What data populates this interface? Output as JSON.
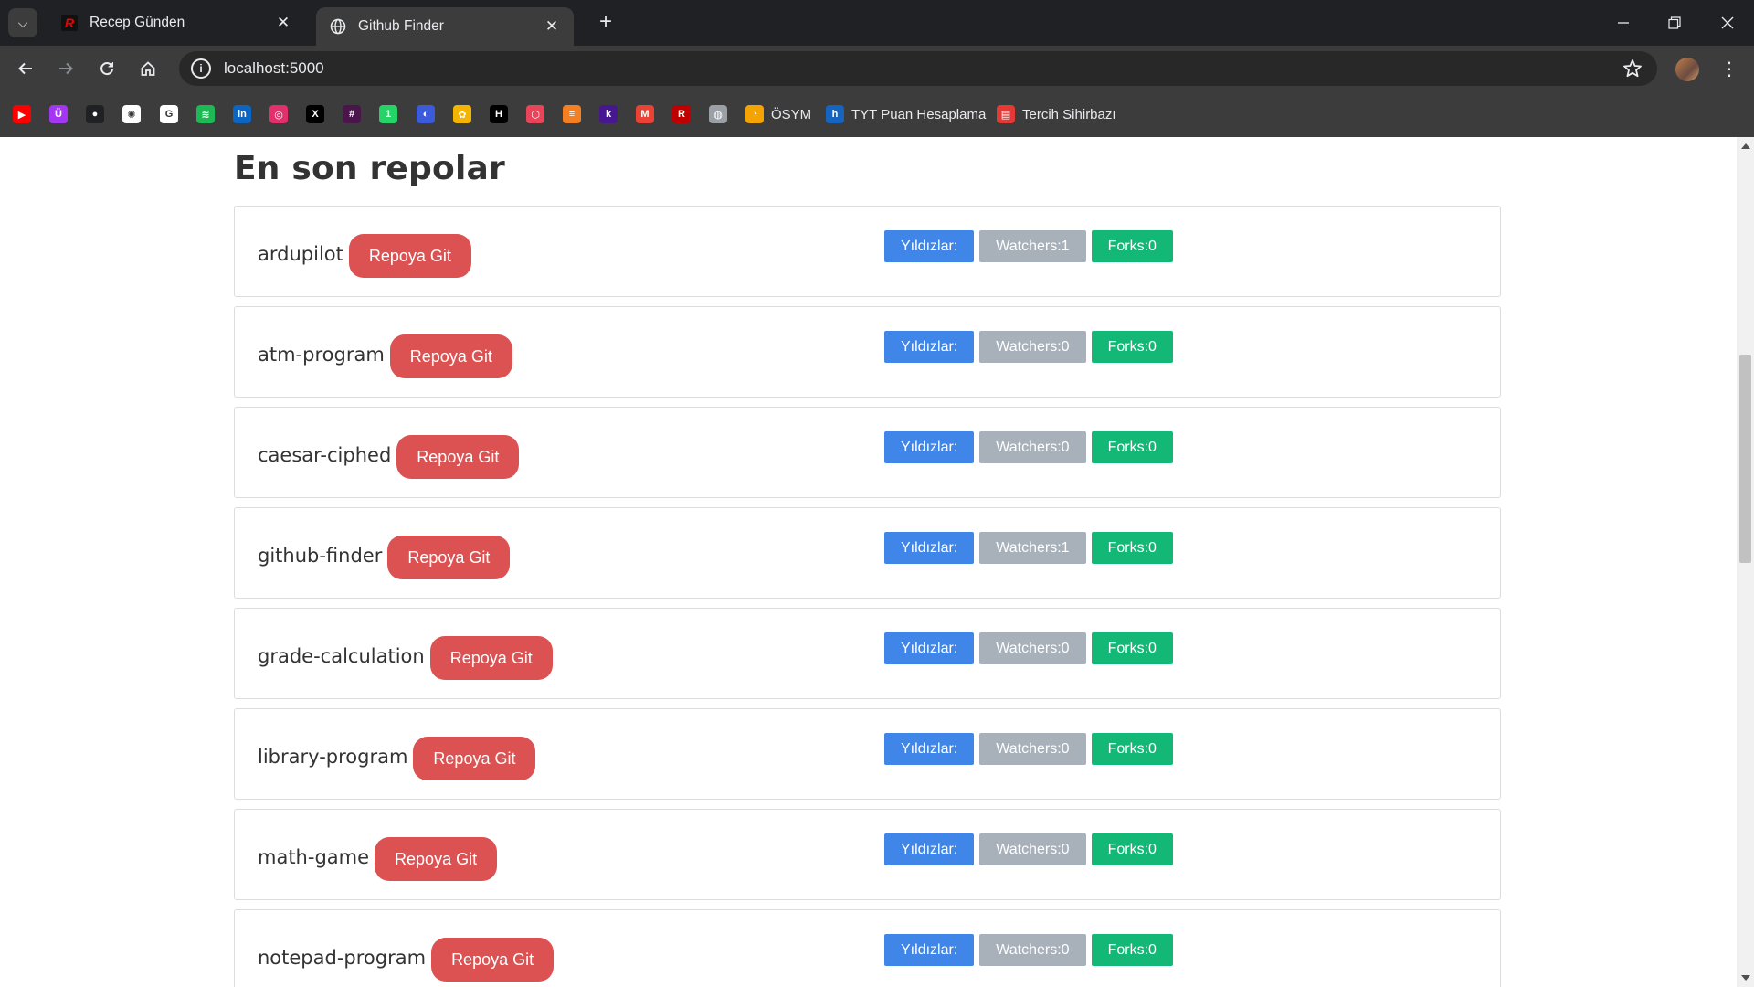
{
  "browser": {
    "tabs": [
      {
        "title": "Recep Günden",
        "active": false
      },
      {
        "title": "Github Finder",
        "active": true
      }
    ],
    "url": "localhost:5000",
    "bookmarks": [
      {
        "icon": "youtube-icon",
        "color": "#ff0000",
        "glyph": "▶",
        "label": ""
      },
      {
        "icon": "udemy-icon",
        "color": "#a435f0",
        "glyph": "Ü",
        "label": ""
      },
      {
        "icon": "github-icon",
        "color": "#202124",
        "glyph": "●",
        "label": ""
      },
      {
        "icon": "chatgpt-icon",
        "color": "#ffffff",
        "glyph": "✺",
        "label": ""
      },
      {
        "icon": "google-icon",
        "color": "#ffffff",
        "glyph": "G",
        "label": ""
      },
      {
        "icon": "spotify-icon",
        "color": "#1db954",
        "glyph": "≋",
        "label": ""
      },
      {
        "icon": "linkedin-icon",
        "color": "#0a66c2",
        "glyph": "in",
        "label": ""
      },
      {
        "icon": "instagram-icon",
        "color": "#e1306c",
        "glyph": "◎",
        "label": ""
      },
      {
        "icon": "x-icon",
        "color": "#000000",
        "glyph": "X",
        "label": ""
      },
      {
        "icon": "slack-icon",
        "color": "#4a154b",
        "glyph": "#",
        "label": ""
      },
      {
        "icon": "whatsapp-icon",
        "color": "#25d366",
        "glyph": "1",
        "label": ""
      },
      {
        "icon": "chrome-extension-icon",
        "color": "#3b5bdb",
        "glyph": "◐",
        "label": ""
      },
      {
        "icon": "photos-icon",
        "color": "#f4b400",
        "glyph": "✿",
        "label": ""
      },
      {
        "icon": "hackernoon-icon",
        "color": "#000000",
        "glyph": "H",
        "label": ""
      },
      {
        "icon": "codepen-icon",
        "color": "#e8445a",
        "glyph": "⬡",
        "label": ""
      },
      {
        "icon": "stackoverflow-icon",
        "color": "#f48024",
        "glyph": "≡",
        "label": ""
      },
      {
        "icon": "kahoot-icon",
        "color": "#46178f",
        "glyph": "k",
        "label": ""
      },
      {
        "icon": "gmail-icon",
        "color": "#ea4335",
        "glyph": "M",
        "label": ""
      },
      {
        "icon": "recep-icon",
        "color": "#c00000",
        "glyph": "R",
        "label": ""
      },
      {
        "icon": "globe-icon",
        "color": "#9aa0a6",
        "glyph": "◍",
        "label": ""
      },
      {
        "icon": "osym-icon",
        "color": "#f4a300",
        "glyph": "◔",
        "label": "ÖSYM"
      },
      {
        "icon": "tyt-icon",
        "color": "#1565c0",
        "glyph": "h",
        "label": "TYT Puan Hesaplama"
      },
      {
        "icon": "tercih-icon",
        "color": "#e53935",
        "glyph": "▤",
        "label": "Tercih Sihirbazı"
      }
    ]
  },
  "page": {
    "heading": "En son repolar",
    "go_label": "Repoya Git",
    "repos": [
      {
        "name": "ardupilot",
        "stars": "Yıldızlar:",
        "watchers": "Watchers:1",
        "forks": "Forks:0"
      },
      {
        "name": "atm-program",
        "stars": "Yıldızlar:",
        "watchers": "Watchers:0",
        "forks": "Forks:0"
      },
      {
        "name": "caesar-ciphed",
        "stars": "Yıldızlar:",
        "watchers": "Watchers:0",
        "forks": "Forks:0"
      },
      {
        "name": "github-finder",
        "stars": "Yıldızlar:",
        "watchers": "Watchers:1",
        "forks": "Forks:0"
      },
      {
        "name": "grade-calculation",
        "stars": "Yıldızlar:",
        "watchers": "Watchers:0",
        "forks": "Forks:0"
      },
      {
        "name": "library-program",
        "stars": "Yıldızlar:",
        "watchers": "Watchers:0",
        "forks": "Forks:0"
      },
      {
        "name": "math-game",
        "stars": "Yıldızlar:",
        "watchers": "Watchers:0",
        "forks": "Forks:0"
      },
      {
        "name": "notepad-program",
        "stars": "Yıldızlar:",
        "watchers": "Watchers:0",
        "forks": "Forks:0"
      }
    ]
  },
  "colors": {
    "go_button": "#dc5252",
    "stars_badge": "#3f86e8",
    "watchers_badge": "#a8b1ba",
    "forks_badge": "#13b877"
  }
}
